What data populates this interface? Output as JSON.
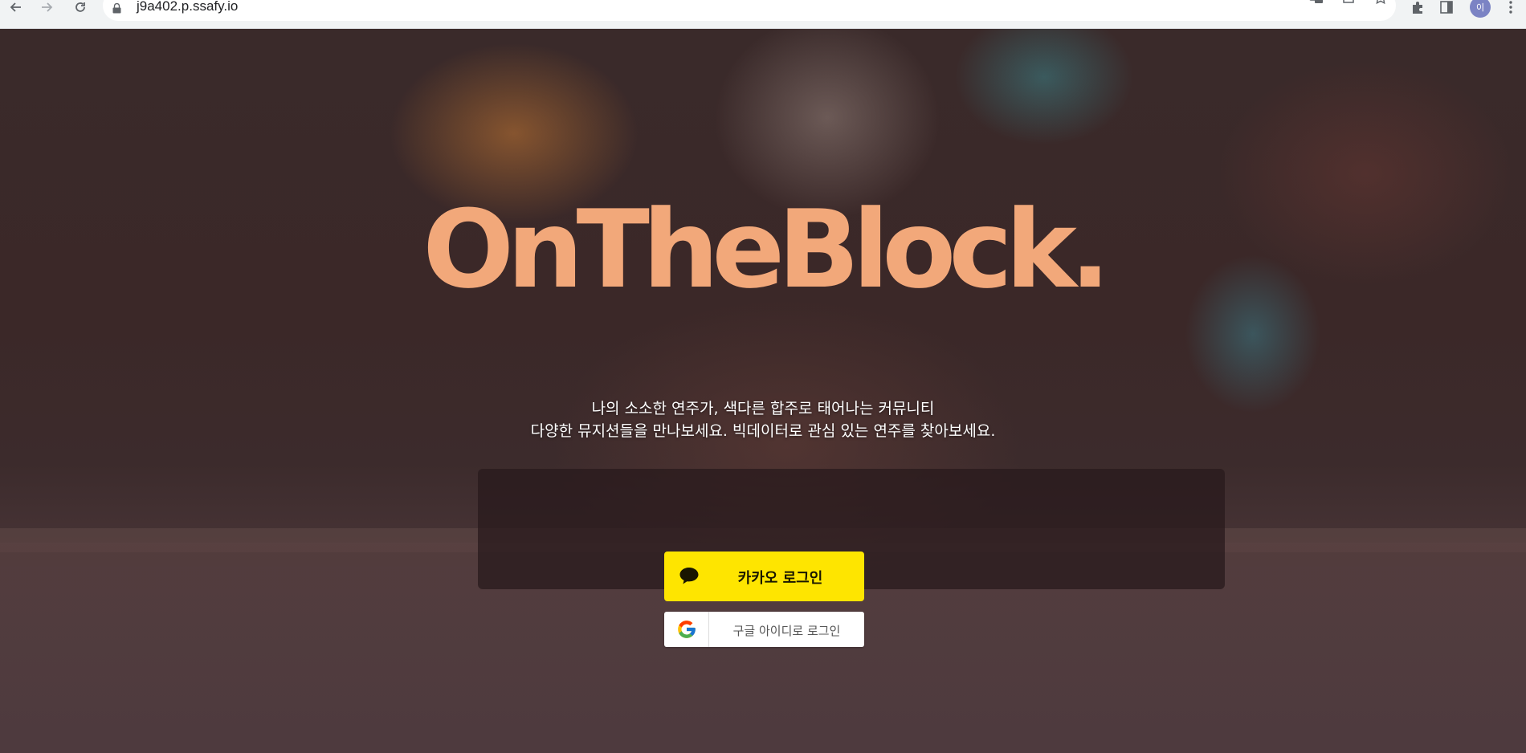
{
  "browser": {
    "url": "j9a402.p.ssafy.io",
    "avatar_initial": "이",
    "icons": {
      "back": "arrow-left-icon",
      "forward": "arrow-right-icon",
      "reload": "reload-icon",
      "lock": "lock-icon",
      "translate": "translate-icon",
      "share": "share-icon",
      "bookmark": "star-icon",
      "extensions": "puzzle-icon",
      "side_panel": "side-panel-icon",
      "menu": "kebab-menu-icon"
    }
  },
  "hero": {
    "logo_text": "OnTheBlock.",
    "logo_color": "#f2a87a",
    "tagline_line1": "나의 소소한 연주가, 색다른 합주로 태어나는 커뮤니티",
    "tagline_line2": "다양한 뮤지션들을 만나보세요. 빅데이터로 관심 있는 연주를 찾아보세요."
  },
  "login": {
    "kakao_label": "카카오 로그인",
    "kakao_color": "#fee500",
    "kakao_icon": "speech-bubble-icon",
    "google_label": "구글 아이디로 로그인",
    "google_icon": "google-g-icon"
  }
}
